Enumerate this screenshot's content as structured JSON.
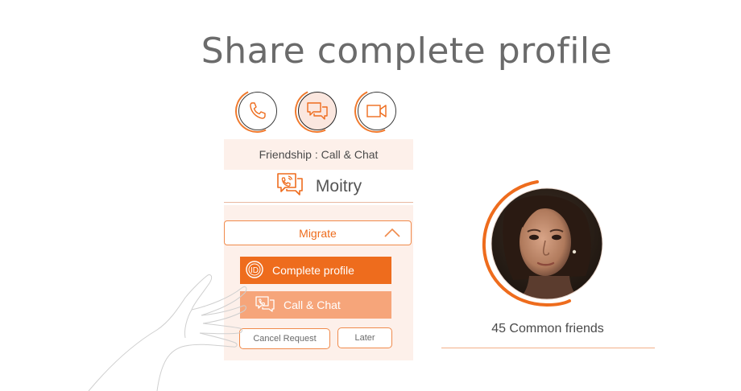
{
  "heading": "Share complete profile",
  "icons": {
    "phone": "phone-icon",
    "chat": "chat-bubbles-icon",
    "video": "video-camera-icon"
  },
  "friendship_label": "Friendship : Call & Chat",
  "contact_name": "Moitry",
  "migrate_label": "Migrate",
  "actions": {
    "complete_profile": "Complete profile",
    "call_chat": "Call & Chat",
    "cancel_request": "Cancel Request",
    "later": "Later"
  },
  "profile": {
    "common_friends": "45 Common friends"
  },
  "colors": {
    "accent": "#ee6c1d",
    "accent_light": "#f6a57a",
    "panel_bg": "#fdf0ea"
  }
}
